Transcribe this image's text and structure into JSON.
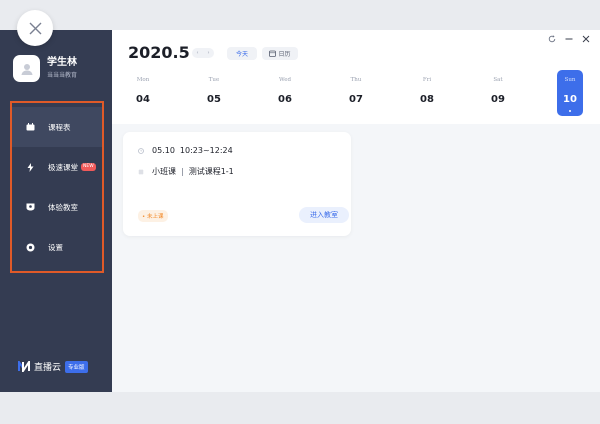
{
  "user": {
    "name": "学生林",
    "school": "当当当教育"
  },
  "nav": [
    {
      "label": "课程表",
      "icon": "calendar-icon",
      "active": true
    },
    {
      "label": "极速课堂",
      "icon": "lightning-icon",
      "badge": "NEW"
    },
    {
      "label": "体验教室",
      "icon": "classroom-icon"
    },
    {
      "label": "设置",
      "icon": "gear-icon"
    }
  ],
  "brand": {
    "name": "直播云",
    "badge": "专业版"
  },
  "header": {
    "month": "2020.5",
    "today_label": "今天",
    "calendar_label": "日历"
  },
  "week": [
    {
      "name": "Mon",
      "num": "04"
    },
    {
      "name": "Tue",
      "num": "05"
    },
    {
      "name": "Wed",
      "num": "06"
    },
    {
      "name": "Thu",
      "num": "07"
    },
    {
      "name": "Fri",
      "num": "08"
    },
    {
      "name": "Sat",
      "num": "09"
    },
    {
      "name": "Sun",
      "num": "10",
      "selected": true
    }
  ],
  "course": {
    "date": "05.10",
    "time": "10:23~12:24",
    "type": "小班课",
    "separator": "|",
    "name": "测试课程1-1",
    "status": "• 未上课",
    "enter_label": "进入教室"
  },
  "colors": {
    "accent": "#3d6eea",
    "sidebar": "#343c52",
    "highlight": "#e05a28"
  }
}
